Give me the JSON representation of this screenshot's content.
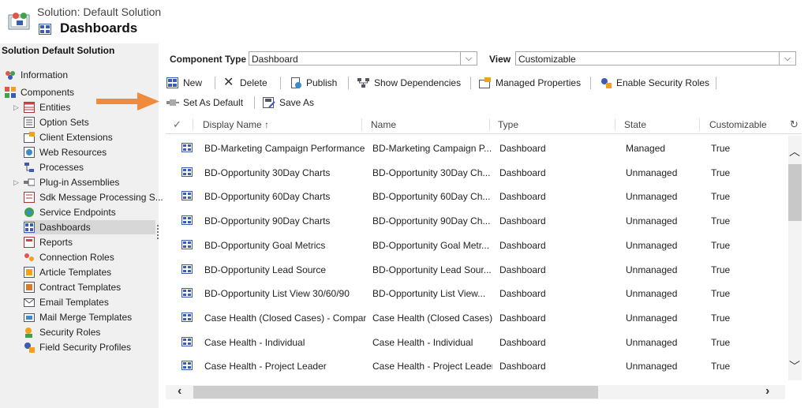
{
  "header": {
    "solution_label": "Solution: Default Solution",
    "page_title": "Dashboards"
  },
  "sidebar": {
    "title": "Solution Default Solution",
    "items": [
      {
        "label": "Information",
        "icon": "information-icon"
      },
      {
        "label": "Components",
        "icon": "components-icon"
      },
      {
        "label": "Entities",
        "icon": "entities-icon"
      },
      {
        "label": "Option Sets",
        "icon": "option-sets-icon"
      },
      {
        "label": "Client Extensions",
        "icon": "client-extensions-icon"
      },
      {
        "label": "Web Resources",
        "icon": "web-resources-icon"
      },
      {
        "label": "Processes",
        "icon": "processes-icon"
      },
      {
        "label": "Plug-in Assemblies",
        "icon": "plugin-assemblies-icon"
      },
      {
        "label": "Sdk Message Processing S...",
        "icon": "sdk-message-icon"
      },
      {
        "label": "Service Endpoints",
        "icon": "service-endpoints-icon"
      },
      {
        "label": "Dashboards",
        "icon": "dashboards-icon"
      },
      {
        "label": "Reports",
        "icon": "reports-icon"
      },
      {
        "label": "Connection Roles",
        "icon": "connection-roles-icon"
      },
      {
        "label": "Article Templates",
        "icon": "article-templates-icon"
      },
      {
        "label": "Contract Templates",
        "icon": "contract-templates-icon"
      },
      {
        "label": "Email Templates",
        "icon": "email-templates-icon"
      },
      {
        "label": "Mail Merge Templates",
        "icon": "mail-merge-templates-icon"
      },
      {
        "label": "Security Roles",
        "icon": "security-roles-icon"
      },
      {
        "label": "Field Security Profiles",
        "icon": "field-security-profiles-icon"
      }
    ],
    "selected": "Dashboards"
  },
  "filters": {
    "component_type_label": "Component Type",
    "component_type_value": "Dashboard",
    "view_label": "View",
    "view_value": "Customizable"
  },
  "toolbar": {
    "new": "New",
    "delete": "Delete",
    "publish": "Publish",
    "show_dependencies": "Show Dependencies",
    "managed_properties": "Managed Properties",
    "enable_security_roles": "Enable Security Roles",
    "set_as_default": "Set As Default",
    "save_as": "Save As"
  },
  "grid": {
    "columns": [
      "Display Name ↑",
      "Name",
      "Type",
      "State",
      "Customizable"
    ],
    "rows": [
      [
        "BD-Marketing Campaign Performance",
        "BD-Marketing Campaign P...",
        "Dashboard",
        "Managed",
        "True"
      ],
      [
        "BD-Opportunity 30Day Charts",
        "BD-Opportunity 30Day Ch...",
        "Dashboard",
        "Unmanaged",
        "True"
      ],
      [
        "BD-Opportunity 60Day Charts",
        "BD-Opportunity 60Day Ch...",
        "Dashboard",
        "Unmanaged",
        "True"
      ],
      [
        "BD-Opportunity 90Day Charts",
        "BD-Opportunity 90Day Ch...",
        "Dashboard",
        "Unmanaged",
        "True"
      ],
      [
        "BD-Opportunity Goal Metrics",
        "BD-Opportunity Goal Metr...",
        "Dashboard",
        "Unmanaged",
        "True"
      ],
      [
        "BD-Opportunity Lead Source",
        "BD-Opportunity Lead Sour...",
        "Dashboard",
        "Unmanaged",
        "True"
      ],
      [
        "BD-Opportunity List View 30/60/90",
        "BD-Opportunity List View...",
        "Dashboard",
        "Unmanaged",
        "True"
      ],
      [
        "Case Health (Closed Cases) - Company",
        "Case Health (Closed Cases)...",
        "Dashboard",
        "Unmanaged",
        "True"
      ],
      [
        "Case Health - Individual",
        "Case Health - Individual",
        "Dashboard",
        "Unmanaged",
        "True"
      ],
      [
        "Case Health - Project Leader",
        "Case Health - Project Leader",
        "Dashboard",
        "Unmanaged",
        "True"
      ]
    ]
  },
  "colors": {
    "arrow": "#f08a3c",
    "selected_bg": "#d7d7d7",
    "sidebar_bg": "#f0f0f0",
    "dashboard_icon": "#3b5bb5"
  }
}
